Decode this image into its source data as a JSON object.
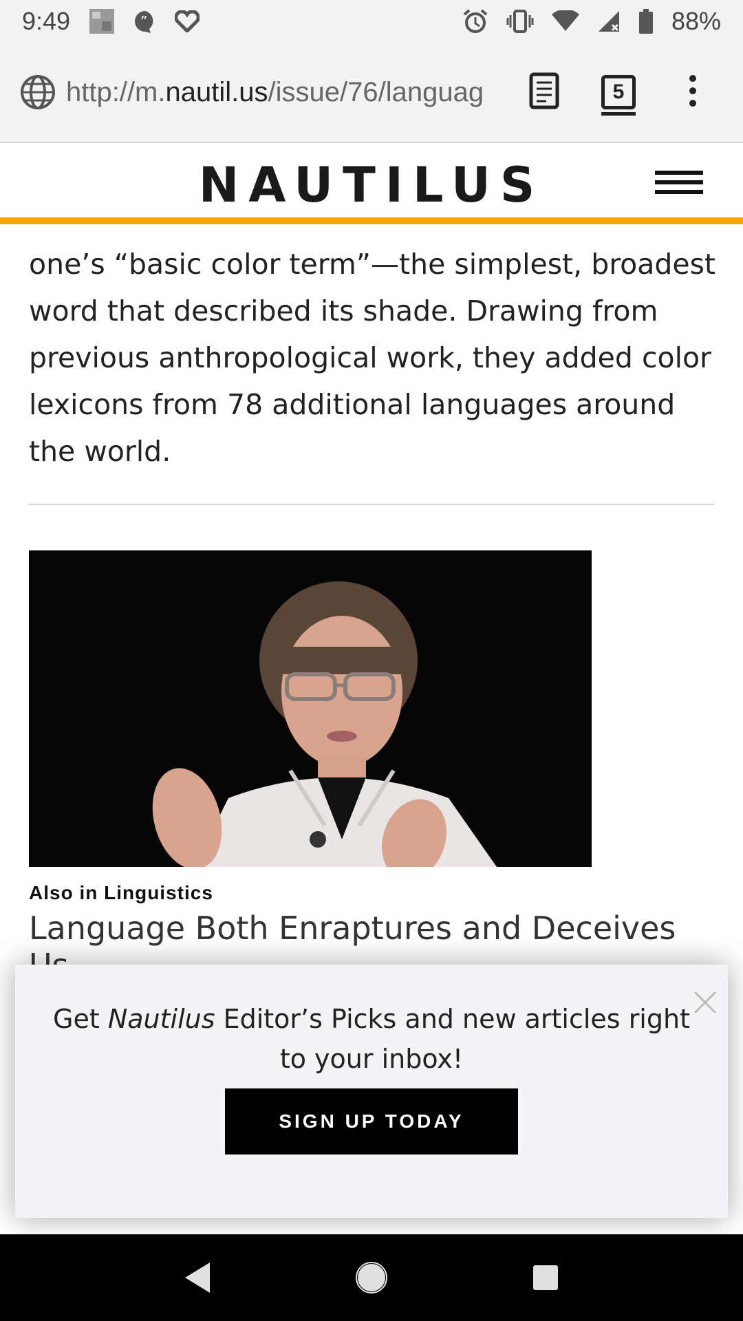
{
  "status_bar": {
    "time": "9:49",
    "battery": "88%"
  },
  "browser": {
    "url_prefix": "http://m.",
    "url_domain": "nautil.us",
    "url_path": "/issue/76/languag",
    "tab_count": "5"
  },
  "site": {
    "logo": "NAUTILUS",
    "accent_color": "#f5a900"
  },
  "article": {
    "paragraph": "one’s “basic color term”—the simplest, broadest word that described its shade. Drawing from previous anthropological work, they added color lexicons from 78 additional languages around the world."
  },
  "related": {
    "kicker": "Also in Linguistics",
    "title": "Language Both Enraptures and Deceives Us"
  },
  "signup": {
    "text_before": "Get ",
    "text_em": "Nautilus",
    "text_after": " Editor’s Picks and new articles right to your inbox!",
    "button_label": "SIGN UP TODAY"
  },
  "icons": [
    "gallery-icon",
    "quote-icon",
    "heart-icon",
    "alarm-icon",
    "vibrate-icon",
    "wifi-icon",
    "signal-icon",
    "battery-icon",
    "globe-icon",
    "reader-mode-icon",
    "tabs-icon",
    "more-icon",
    "menu-icon",
    "close-icon",
    "back-icon",
    "home-icon",
    "recents-icon"
  ]
}
